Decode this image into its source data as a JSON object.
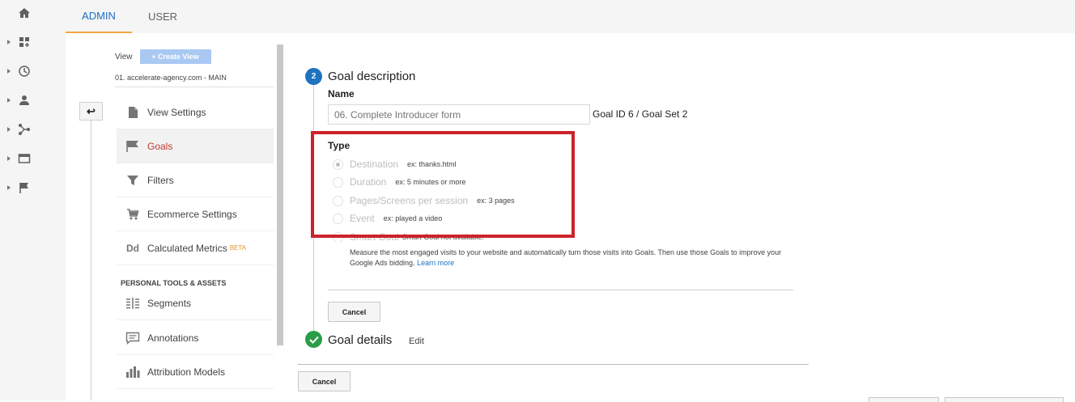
{
  "tabs": {
    "admin": "ADMIN",
    "user": "USER"
  },
  "rail_icons": [
    "home-icon",
    "dashboard-icon",
    "clock-icon",
    "person-icon",
    "acquisition-icon",
    "behavior-icon",
    "flag-icon"
  ],
  "sidebar": {
    "view_label": "View",
    "create_view": "+ Create View",
    "account_name": "01. accelerate-agency.com - MAIN",
    "items": [
      {
        "label": "View Settings",
        "icon": "document-icon"
      },
      {
        "label": "Goals",
        "icon": "flag-icon",
        "active": true
      },
      {
        "label": "Filters",
        "icon": "funnel-icon"
      },
      {
        "label": "Ecommerce Settings",
        "icon": "cart-icon"
      },
      {
        "label": "Calculated Metrics",
        "icon": "dd-icon",
        "badge": "BETA"
      }
    ],
    "section_header": "PERSONAL TOOLS & ASSETS",
    "tools": [
      {
        "label": "Segments",
        "icon": "segments-icon"
      },
      {
        "label": "Annotations",
        "icon": "annotation-icon"
      },
      {
        "label": "Attribution Models",
        "icon": "bar-chart-icon"
      }
    ]
  },
  "back_button": "↩",
  "goal_description": {
    "step_number": "2",
    "title": "Goal description",
    "name_label": "Name",
    "name_placeholder": "06. Complete Introducer form",
    "goal_id": "Goal ID 6 / Goal Set 2",
    "type_label": "Type",
    "types": [
      {
        "label": "Destination",
        "example": "ex: thanks.html",
        "checked": true
      },
      {
        "label": "Duration",
        "example": "ex: 5 minutes or more",
        "checked": false
      },
      {
        "label": "Pages/Screens per session",
        "example": "ex: 3 pages",
        "checked": false
      },
      {
        "label": "Event",
        "example": "ex: played a video",
        "checked": false
      }
    ],
    "smart_goal_label": "Smart Goal",
    "smart_goal_note": "Smart Goal not available.",
    "smart_goal_desc": "Measure the most engaged visits to your website and automatically turn those visits into Goals. Then use those Goals to improve your Google Ads bidding.",
    "learn_more": "Learn more",
    "cancel": "Cancel"
  },
  "goal_details": {
    "title": "Goal details",
    "edit": "Edit"
  },
  "footer": {
    "cancel": "Cancel"
  },
  "colors": {
    "accent_blue": "#1e73be",
    "highlight_red": "#cc2229",
    "active_red": "#c0392b",
    "success_green": "#2a9d48",
    "tab_underline": "#f0a640"
  }
}
